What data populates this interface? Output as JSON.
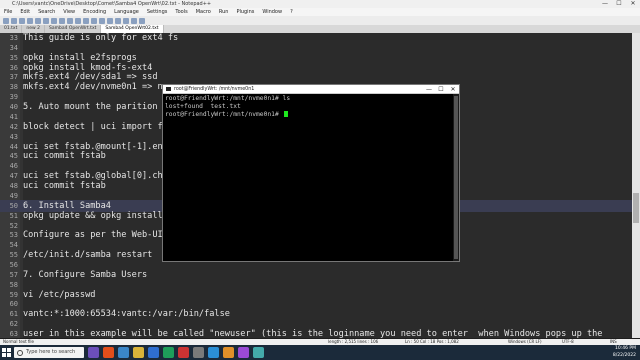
{
  "window": {
    "title": "C:\\Users\\vantc\\OneDrive\\Desktop\\Comet\\Samba4 OpenWrt\\02.txt - Notepad++",
    "controls": [
      "—",
      "☐",
      "✕"
    ]
  },
  "menu": [
    "File",
    "Edit",
    "Search",
    "View",
    "Encoding",
    "Language",
    "Settings",
    "Tools",
    "Macro",
    "Run",
    "Plugins",
    "Window",
    "?"
  ],
  "tabs": [
    {
      "label": "01.txt"
    },
    {
      "label": "new 2"
    },
    {
      "label": "Samba4 OpenWrt.txt"
    },
    {
      "label": "Samba4 OpenWrt02.txt",
      "active": true
    }
  ],
  "editor": {
    "lines": [
      {
        "n": "33",
        "text": "This guide is only for ext4 fs"
      },
      {
        "n": "34",
        "text": ""
      },
      {
        "n": "35",
        "text": "opkg install e2fsprogs"
      },
      {
        "n": "36",
        "text": "opkg install kmod-fs-ext4"
      },
      {
        "n": "37",
        "text": "mkfs.ext4 /dev/sda1 => ssd"
      },
      {
        "n": "38",
        "text": "mkfs.ext4 /dev/nvme0n1 => nv"
      },
      {
        "n": "39",
        "text": ""
      },
      {
        "n": "40",
        "text": "5. Auto mount the parition f"
      },
      {
        "n": "41",
        "text": ""
      },
      {
        "n": "42",
        "text": "block detect | uci import fs"
      },
      {
        "n": "43",
        "text": ""
      },
      {
        "n": "44",
        "text": "uci set fstab.@mount[-1].ena"
      },
      {
        "n": "45",
        "text": "uci commit fstab"
      },
      {
        "n": "46",
        "text": ""
      },
      {
        "n": "47",
        "text": "uci set fstab.@global[0].che"
      },
      {
        "n": "48",
        "text": "uci commit fstab"
      },
      {
        "n": "49",
        "text": ""
      },
      {
        "n": "50",
        "text": "6. Install Samba4",
        "current": true
      },
      {
        "n": "51",
        "text": "opkg update && opkg install"
      },
      {
        "n": "52",
        "text": ""
      },
      {
        "n": "53",
        "text": "Configure as per the Web-UI"
      },
      {
        "n": "54",
        "text": ""
      },
      {
        "n": "55",
        "text": "/etc/init.d/samba restart"
      },
      {
        "n": "56",
        "text": ""
      },
      {
        "n": "57",
        "text": "7. Configure Samba Users"
      },
      {
        "n": "58",
        "text": ""
      },
      {
        "n": "59",
        "text": "vi /etc/passwd"
      },
      {
        "n": "60",
        "text": ""
      },
      {
        "n": "61",
        "text": "vantc:*:1000:65534:vantc:/var:/bin/false"
      },
      {
        "n": "62",
        "text": ""
      },
      {
        "n": "63",
        "text": "user in this example will be called \"newuser\" (this is the loginname you need to enter  when Windows pops up the"
      }
    ]
  },
  "terminal": {
    "title": "root@FriendlyWrt: /mnt/nvme0n1",
    "lines": [
      "root@FriendlyWrt:/mnt/nvme0n1# ls",
      "lost+found  test.txt",
      "root@FriendlyWrt:/mnt/nvme0n1# "
    ],
    "controls": [
      "—",
      "☐",
      "✕"
    ]
  },
  "status": {
    "file_type": "Normal text file",
    "length": "length : 2,515    lines : 106",
    "position": "Ln : 50    Col : 18    Pos : 1,082",
    "eol": "Windows (CR LF)",
    "encoding": "UTF-8",
    "mode": "INS"
  },
  "taskbar": {
    "search_placeholder": "Type here to search",
    "app_colors": [
      "#6b4fbb",
      "#e24e1b",
      "#3a86c8",
      "#d9b43a",
      "#2f6fd1",
      "#1e9e5a",
      "#c33",
      "#7a7a7a",
      "#2b8fd6",
      "#e0902a",
      "#9a4ad6",
      "#4aa"
    ],
    "time": "10:46 PM",
    "date": "8/22/2022"
  },
  "colors": {
    "editor_bg": "#2b2b2b",
    "current_line": "#3a3d52",
    "cursor": "#1ee81e",
    "taskbar": "#1b2a3a"
  }
}
